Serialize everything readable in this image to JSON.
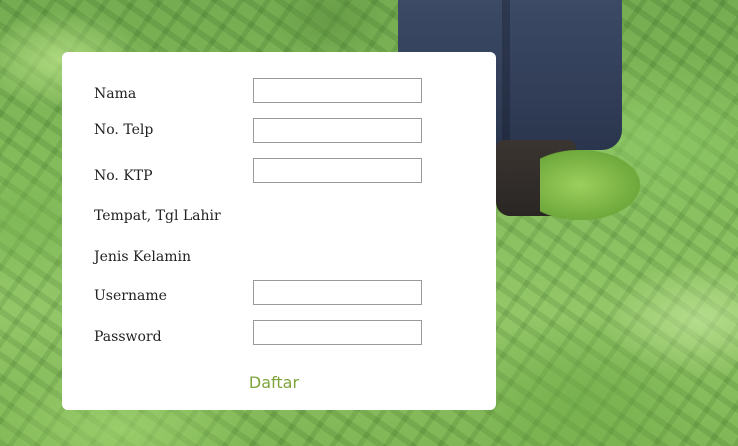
{
  "form": {
    "fields": [
      {
        "label": "Nama",
        "value": "",
        "placeholder": ""
      },
      {
        "label": "No. Telp",
        "value": "",
        "placeholder": ""
      },
      {
        "label": "No. KTP",
        "value": "",
        "placeholder": ""
      },
      {
        "label": "Tempat, Tgl Lahir"
      },
      {
        "label": "Jenis Kelamin"
      },
      {
        "label": "Username",
        "value": "",
        "placeholder": ""
      },
      {
        "label": "Password",
        "value": "",
        "placeholder": ""
      }
    ],
    "submit_label": "Daftar"
  },
  "colors": {
    "accent": "#7ea33a",
    "card": "#ffffff",
    "field_border": "#9a9a9a"
  }
}
